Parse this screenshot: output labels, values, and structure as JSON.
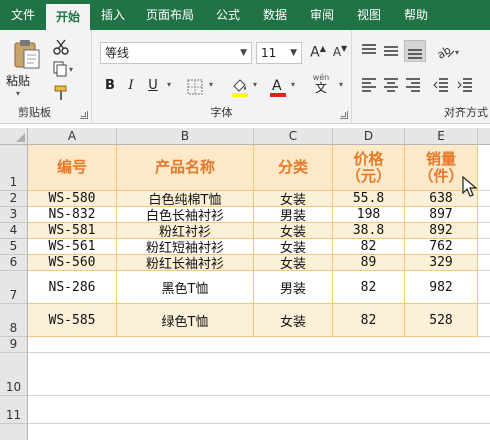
{
  "ribbon_tabs": [
    {
      "label": "文件",
      "active": false
    },
    {
      "label": "开始",
      "active": true
    },
    {
      "label": "插入",
      "active": false
    },
    {
      "label": "页面布局",
      "active": false
    },
    {
      "label": "公式",
      "active": false
    },
    {
      "label": "数据",
      "active": false
    },
    {
      "label": "审阅",
      "active": false
    },
    {
      "label": "视图",
      "active": false
    },
    {
      "label": "帮助",
      "active": false
    }
  ],
  "clipboard": {
    "paste_label": "粘贴",
    "group_label": "剪贴板"
  },
  "font": {
    "name": "等线",
    "size": "11",
    "group_label": "字体",
    "wen_label": "wén",
    "wen_char": "文"
  },
  "alignment": {
    "group_label": "对齐方式"
  },
  "columns": [
    "A",
    "B",
    "C",
    "D",
    "E"
  ],
  "row_numbers": [
    "1",
    "2",
    "3",
    "4",
    "5",
    "6",
    "7",
    "8",
    "9",
    "10",
    "11"
  ],
  "headers": {
    "a": "编号",
    "b": "产品名称",
    "c": "分类",
    "d_line1": "价格",
    "d_line2": "（元）",
    "e_line1": "销量",
    "e_line2": "（件）"
  },
  "rows": [
    {
      "id": "WS-580",
      "name": "白色纯棉T恤",
      "category": "女装",
      "price": "55.8",
      "sales": "638"
    },
    {
      "id": "NS-832",
      "name": "白色长袖衬衫",
      "category": "男装",
      "price": "198",
      "sales": "897"
    },
    {
      "id": "WS-581",
      "name": "粉红衬衫",
      "category": "女装",
      "price": "38.8",
      "sales": "892"
    },
    {
      "id": "WS-561",
      "name": "粉红短袖衬衫",
      "category": "女装",
      "price": "82",
      "sales": "762"
    },
    {
      "id": "WS-560",
      "name": "粉红长袖衬衫",
      "category": "女装",
      "price": "89",
      "sales": "329"
    },
    {
      "id": "NS-286",
      "name": "黑色T恤",
      "category": "男装",
      "price": "82",
      "sales": "982"
    },
    {
      "id": "WS-585",
      "name": "绿色T恤",
      "category": "女装",
      "price": "82",
      "sales": "528"
    }
  ],
  "colors": {
    "ribbon_green": "#217346",
    "header_fill": "#fde9c8",
    "header_text": "#e5792a",
    "band_fill": "#fdf0d9",
    "band_border": "#f6c77b"
  }
}
